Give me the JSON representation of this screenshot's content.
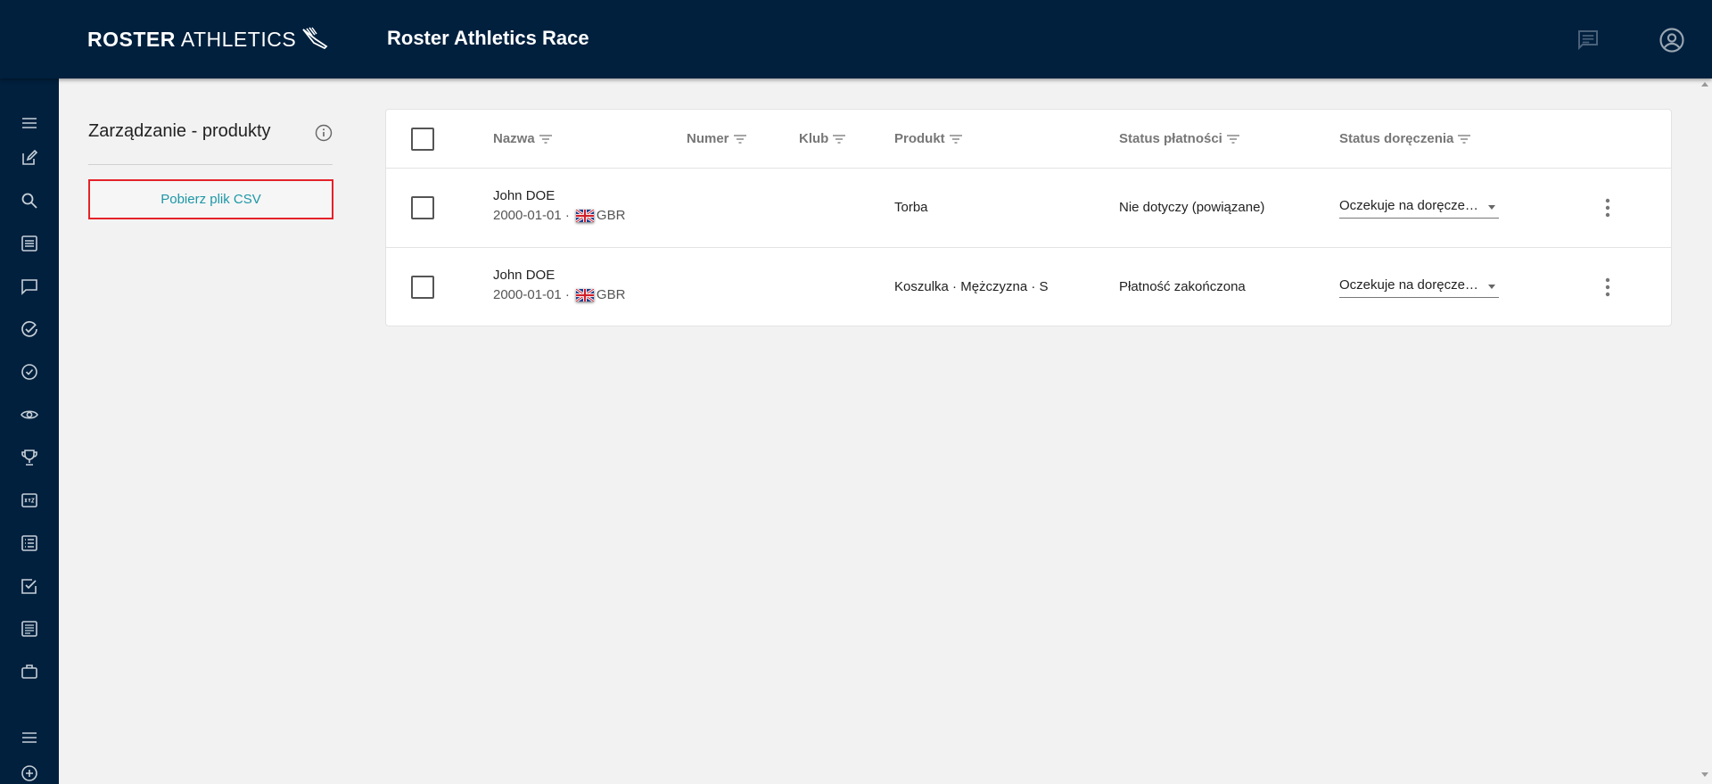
{
  "header": {
    "logo_bold": "ROSTER",
    "logo_light": "ATHLETICS",
    "app_title": "Roster Athletics Race",
    "icons": [
      "chat-icon",
      "account-circle-icon"
    ]
  },
  "sidebar": {
    "icons": [
      "menu-icon",
      "edit-icon",
      "search-icon",
      "list-icon",
      "chat-icon",
      "check-circle-icon",
      "check-circle-icon",
      "eye-icon",
      "trophy-icon",
      "xyz-icon",
      "list-alt-icon",
      "checkbox-icon",
      "notes-icon",
      "briefcase-icon",
      "menu-icon",
      "add-circle-icon"
    ]
  },
  "panel": {
    "title": "Zarządzanie - produkty",
    "csv_button": "Pobierz plik CSV"
  },
  "table": {
    "headers": {
      "name": "Nazwa",
      "number": "Numer",
      "club": "Klub",
      "product": "Produkt",
      "payment_status": "Status płatności",
      "delivery_status": "Status doręczenia"
    },
    "rows": [
      {
        "name": "John DOE",
        "dob": "2000-01-01 ·",
        "country": "GBR",
        "product": "Torba",
        "payment_status": "Nie dotyczy (powiązane)",
        "delivery_status": "Oczekuje na doręczenie"
      },
      {
        "name": "John DOE",
        "dob": "2000-01-01 ·",
        "country": "GBR",
        "product": "Koszulka · Mężczyzna · S",
        "payment_status": "Płatność zakończona",
        "delivery_status": "Oczekuje na doręczenie"
      }
    ]
  },
  "colors": {
    "navy": "#00203e",
    "accent": "#1d97a6",
    "highlight": "#e52229"
  }
}
